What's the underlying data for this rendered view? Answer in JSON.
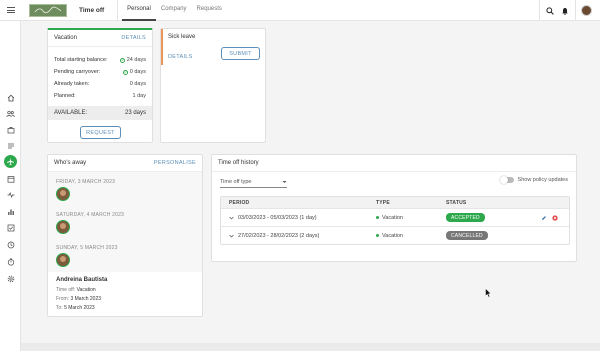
{
  "topbar": {
    "title": "Time off",
    "tabs": [
      {
        "label": "Personal",
        "active": true
      },
      {
        "label": "Company",
        "active": false
      },
      {
        "label": "Requests",
        "active": false
      }
    ]
  },
  "leftnav": {
    "items": [
      "home-icon",
      "people-icon",
      "briefcase-icon",
      "list-icon",
      "plane-icon",
      "calendar-icon",
      "activity-icon",
      "bar-chart-icon",
      "checklist-icon",
      "clock-icon",
      "timer-icon",
      "gear-icon"
    ],
    "active": "plane-icon"
  },
  "vacation": {
    "title": "Vacation",
    "details_label": "DETAILS",
    "rows": [
      {
        "label": "Total starting balance:",
        "value": "24 days",
        "check": true
      },
      {
        "label": "Pending carryover:",
        "value": "0 days",
        "check": true
      },
      {
        "label": "Already taken:",
        "value": "0 days",
        "check": false
      },
      {
        "label": "Planned:",
        "value": "1 day",
        "check": false
      }
    ],
    "available_label": "AVAILABLE:",
    "available_value": "23 days",
    "request_label": "REQUEST"
  },
  "sick": {
    "title": "Sick leave",
    "submit_label": "SUBMIT",
    "details_label": "DETAILS"
  },
  "away": {
    "title": "Who's away",
    "personalise_label": "PERSONALISE",
    "days": [
      "FRIDAY, 3 MARCH 2023",
      "SATURDAY, 4 MARCH 2023",
      "SUNDAY, 5 MARCH 2023"
    ],
    "person": {
      "name": "Andreina Bautista",
      "timeoff_label": "Time off:",
      "timeoff_value": "Vacation",
      "from_label": "From:",
      "from_value": "3 March 2023",
      "to_label": "To:",
      "to_value": "5 March 2023"
    }
  },
  "history": {
    "title": "Time off history",
    "filter_placeholder": "Time off type",
    "toggle_label": "Show policy updates",
    "columns": [
      "PERIOD",
      "TYPE",
      "STATUS"
    ],
    "rows": [
      {
        "period": "03/03/2023 - 05/03/2023 (1 day)",
        "type": "Vacation",
        "status": "ACCEPTED"
      },
      {
        "period": "27/02/2023 - 28/02/2023 (2 days)",
        "type": "Vacation",
        "status": "CANCELLED"
      }
    ]
  },
  "colors": {
    "accent_green": "#2ea84c",
    "link_blue": "#5b8fb9",
    "sick_orange": "#f0955a",
    "cancelled_grey": "#777777"
  }
}
